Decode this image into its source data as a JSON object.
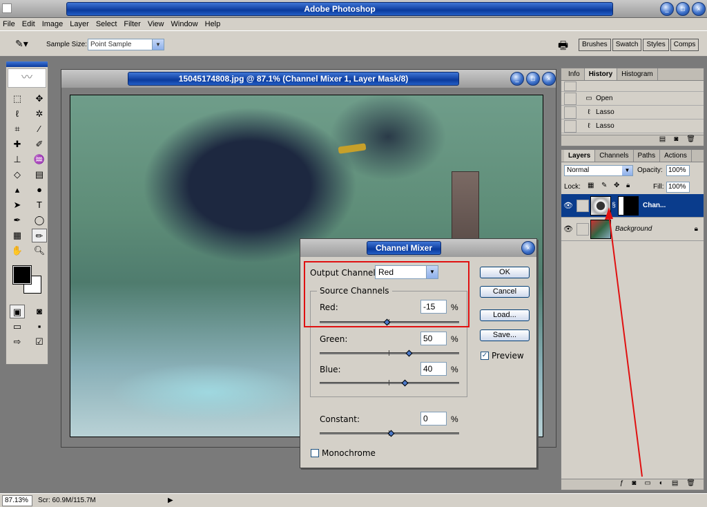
{
  "app": {
    "title": "Adobe Photoshop"
  },
  "menu": [
    "File",
    "Edit",
    "Image",
    "Layer",
    "Select",
    "Filter",
    "View",
    "Window",
    "Help"
  ],
  "options": {
    "sample_size_label": "Sample Size:",
    "sample_size_value": "Point Sample"
  },
  "palette_well": [
    "Brushes",
    "Swatch",
    "Styles",
    "Comps"
  ],
  "document": {
    "title": "15045174808.jpg @ 87.1% (Channel Mixer 1, Layer Mask/8)"
  },
  "dialog": {
    "title": "Channel Mixer",
    "output_channel_label": "Output Channel:",
    "output_channel_value": "Red",
    "source_group_label": "Source Channels",
    "red_label": "Red:",
    "red_value": "-15",
    "green_label": "Green:",
    "green_value": "50",
    "blue_label": "Blue:",
    "blue_value": "40",
    "constant_label": "Constant:",
    "constant_value": "0",
    "pct": "%",
    "monochrome_label": "Monochrome",
    "monochrome_checked": false,
    "preview_label": "Preview",
    "preview_checked": true,
    "ok_label": "OK",
    "cancel_label": "Cancel",
    "load_label": "Load...",
    "save_label": "Save..."
  },
  "history_panel": {
    "tabs": [
      "Info",
      "History",
      "Histogram"
    ],
    "rows": [
      "Open",
      "Lasso",
      "Lasso"
    ]
  },
  "layers_panel": {
    "tabs": [
      "Layers",
      "Channels",
      "Paths",
      "Actions"
    ],
    "blend_mode": "Normal",
    "opacity_label": "Opacity:",
    "opacity_value": "100%",
    "lock_label": "Lock:",
    "fill_label": "Fill:",
    "fill_value": "100%",
    "layers": [
      {
        "name": "Chan...",
        "selected": true
      },
      {
        "name": "Background",
        "selected": false
      }
    ]
  },
  "status": {
    "zoom": "87.13%",
    "scratch": "Scr: 60.9M/115.7M"
  }
}
